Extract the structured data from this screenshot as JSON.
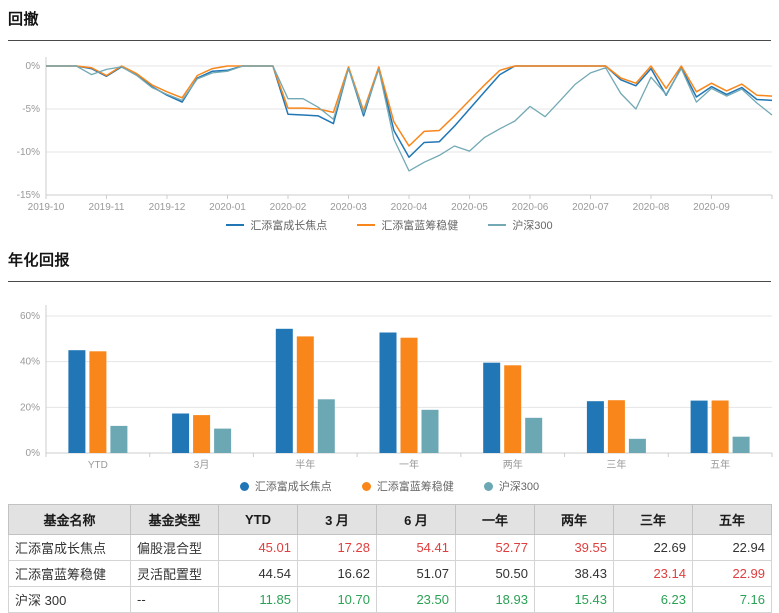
{
  "sections": {
    "drawdown": {
      "title": "回撤"
    },
    "annualized": {
      "title": "年化回报"
    }
  },
  "palette": {
    "blue": "#2176b5",
    "orange": "#f8861b",
    "teal": "#6ca8b4",
    "red": "#e03e3e",
    "green": "#2ba155",
    "axis_text": "#999999",
    "grid": "#e5e5e5",
    "axis_line": "#cccccc",
    "legend_text": "#666666"
  },
  "chart_data": [
    {
      "id": "drawdown",
      "type": "line",
      "title": "回撤",
      "x_ticks": [
        "2019-10",
        "2019-11",
        "2019-12",
        "2020-01",
        "2020-02",
        "2020-03",
        "2020-04",
        "2020-05",
        "2020-06",
        "2020-07",
        "2020-08",
        "2020-09"
      ],
      "ylim": [
        -15,
        0
      ],
      "y_ticks": [
        0,
        -5,
        -10,
        -15
      ],
      "unit": "%",
      "grid": true,
      "legend_position": "bottom",
      "series": [
        {
          "name": "汇添富成长焦点",
          "color": "#2176b5",
          "values": [
            0,
            0,
            0,
            -0.3,
            -1.2,
            -0.1,
            -1.0,
            -2.4,
            -3.4,
            -4.2,
            -1.4,
            -0.6,
            -0.5,
            0,
            0,
            0,
            -5.6,
            -5.7,
            -5.8,
            -6.7,
            -0.2,
            -5.8,
            -0.2,
            -7.5,
            -10.6,
            -8.9,
            -8.8,
            -7.0,
            -5.0,
            -3.0,
            -1.0,
            0,
            0,
            0,
            0,
            0,
            0,
            0,
            -1.6,
            -2.3,
            -0.3,
            -3.4,
            -0.2,
            -3.6,
            -2.4,
            -3.3,
            -2.5,
            -3.9,
            -4.0
          ]
        },
        {
          "name": "汇添富蓝筹稳健",
          "color": "#f8861b",
          "values": [
            0,
            0,
            0,
            -0.2,
            -1.1,
            0,
            -0.9,
            -2.2,
            -3.0,
            -3.7,
            -1.1,
            -0.3,
            0,
            0,
            0,
            0,
            -4.9,
            -4.9,
            -5.0,
            -5.4,
            -0.1,
            -5.2,
            -0.1,
            -6.5,
            -9.3,
            -7.6,
            -7.5,
            -5.8,
            -4.0,
            -2.2,
            -0.5,
            0,
            0,
            0,
            0,
            0,
            0,
            0,
            -1.4,
            -2.0,
            0,
            -2.6,
            0,
            -3.0,
            -2.0,
            -2.9,
            -2.1,
            -3.4,
            -3.5
          ]
        },
        {
          "name": "沪深300",
          "color": "#72a9b4",
          "values": [
            0,
            0,
            0,
            -1.0,
            -0.4,
            -0.1,
            -1.1,
            -2.5,
            -3.3,
            -4.0,
            -1.5,
            -0.8,
            -0.6,
            0,
            0,
            0,
            -3.8,
            -3.8,
            -4.8,
            -6.2,
            -0.3,
            -5.5,
            -0.4,
            -8.5,
            -12.2,
            -11.2,
            -10.4,
            -9.3,
            -9.9,
            -8.3,
            -7.3,
            -6.4,
            -4.7,
            -5.9,
            -4.0,
            -2.1,
            -0.8,
            -0.2,
            -3.2,
            -5.0,
            -1.3,
            -3.3,
            -0.3,
            -4.2,
            -2.6,
            -3.5,
            -2.7,
            -4.3,
            -5.7
          ]
        }
      ]
    },
    {
      "id": "annualized_return",
      "type": "bar",
      "title": "年化回报",
      "categories": [
        "YTD",
        "3月",
        "半年",
        "一年",
        "两年",
        "三年",
        "五年"
      ],
      "ylim": [
        0,
        60
      ],
      "y_ticks": [
        0,
        20,
        40,
        60
      ],
      "unit": "%",
      "grid": true,
      "legend_position": "bottom",
      "series": [
        {
          "name": "汇添富成长焦点",
          "color": "#2176b5",
          "values": [
            45.01,
            17.28,
            54.41,
            52.77,
            39.55,
            22.69,
            22.94
          ]
        },
        {
          "name": "汇添富蓝筹稳健",
          "color": "#f8861b",
          "values": [
            44.54,
            16.62,
            51.07,
            50.5,
            38.43,
            23.14,
            22.99
          ]
        },
        {
          "name": "沪深300",
          "color": "#6ca8b4",
          "values": [
            11.85,
            10.7,
            23.5,
            18.93,
            15.43,
            6.23,
            7.16
          ]
        }
      ]
    }
  ],
  "table": {
    "columns": [
      "基金名称",
      "基金类型",
      "YTD",
      "3 月",
      "6 月",
      "一年",
      "两年",
      "三年",
      "五年"
    ],
    "rows": [
      {
        "cells": [
          "汇添富成长焦点",
          "偏股混合型",
          "45.01",
          "17.28",
          "54.41",
          "52.77",
          "39.55",
          "22.69",
          "22.94"
        ],
        "colors": [
          "black",
          "black",
          "red",
          "red",
          "red",
          "red",
          "red",
          "black",
          "black"
        ]
      },
      {
        "cells": [
          "汇添富蓝筹稳健",
          "灵活配置型",
          "44.54",
          "16.62",
          "51.07",
          "50.50",
          "38.43",
          "23.14",
          "22.99"
        ],
        "colors": [
          "black",
          "black",
          "black",
          "black",
          "black",
          "black",
          "black",
          "red",
          "red"
        ]
      },
      {
        "cells": [
          "沪深 300",
          "--",
          "11.85",
          "10.70",
          "23.50",
          "18.93",
          "15.43",
          "6.23",
          "7.16"
        ],
        "colors": [
          "black",
          "black",
          "green",
          "green",
          "green",
          "green",
          "green",
          "green",
          "green"
        ]
      }
    ]
  }
}
